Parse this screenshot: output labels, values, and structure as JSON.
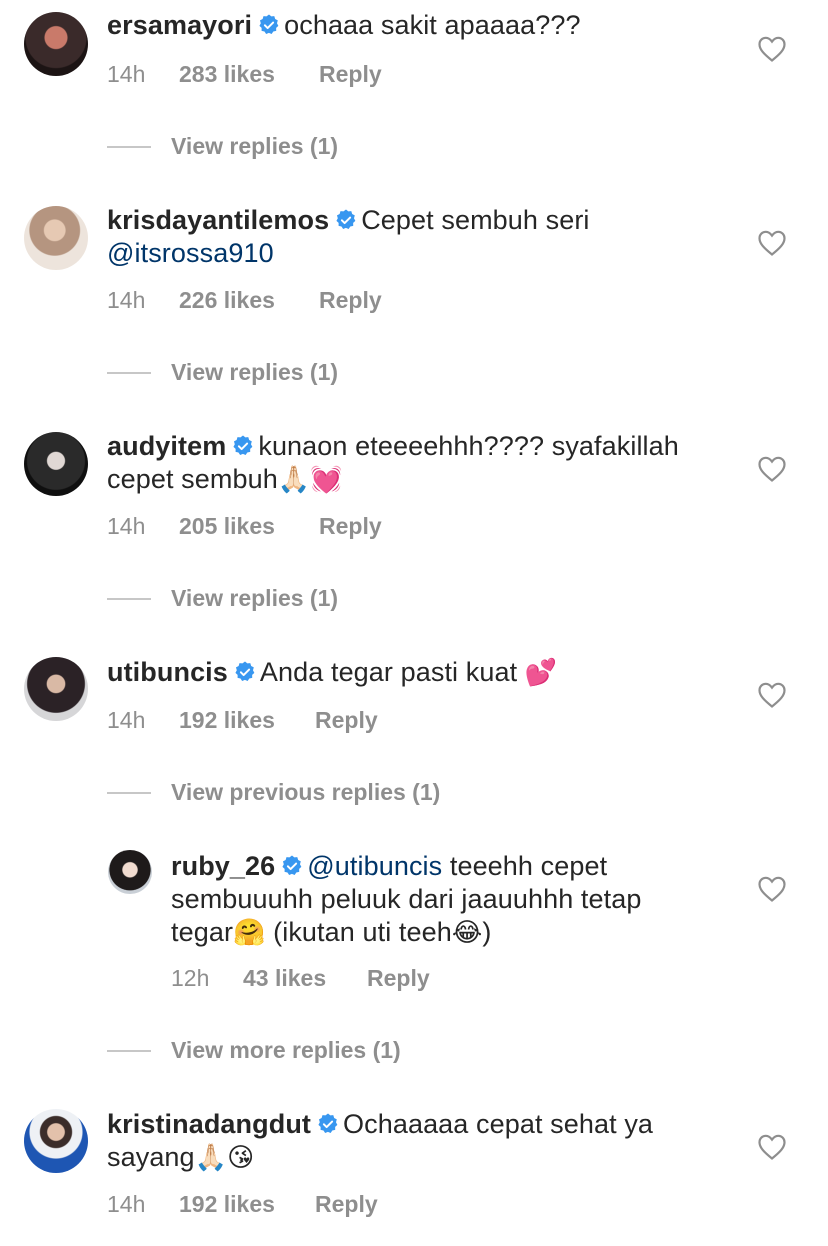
{
  "comments": [
    {
      "username": "ersamayori",
      "text": "ochaaa sakit apaaaa???",
      "time": "14h",
      "likes": "283 likes",
      "reply": "Reply",
      "view": "View replies (1)"
    },
    {
      "username": "krisdayantilemos",
      "text": "Cepet sembuh seri",
      "mention": "@itsrossa910",
      "time": "14h",
      "likes": "226 likes",
      "reply": "Reply",
      "view": "View replies (1)"
    },
    {
      "username": "audyitem",
      "text_line1": "kunaon eteeeehhh???? syafakillah",
      "text_line2": "cepet sembuh",
      "emoji": "🙏🏻💓",
      "time": "14h",
      "likes": "205 likes",
      "reply": "Reply",
      "view": "View replies (1)"
    },
    {
      "username": "utibuncis",
      "text": "Anda tegar pasti kuat",
      "emoji": "💕",
      "time": "14h",
      "likes": "192 likes",
      "reply": "Reply",
      "view": "View previous replies (1)"
    },
    {
      "username": "kristinadangdut",
      "text_line1": "Ochaaaaa cepat sehat ya",
      "text_line2": "sayang",
      "emoji": "🙏🏻😘",
      "time": "14h",
      "likes": "192 likes",
      "reply": "Reply"
    }
  ],
  "reply": {
    "username": "ruby_26",
    "mention": "@utibuncis",
    "text_a": " teeehh cepet",
    "text_b": "sembuuuhh peluuk dari jaauuhhh tetap",
    "text_c1": "tegar",
    "emoji1": "🤗",
    "text_c2": " (ikutan uti teeh",
    "emoji2": "😂",
    "text_c3": ")",
    "time": "12h",
    "likes": "43 likes",
    "reply": "Reply",
    "view": "View more replies (1)"
  },
  "colors": {
    "text": "#262626",
    "meta": "#8e8e8e",
    "mention": "#003569",
    "verified": "#3897f0"
  }
}
